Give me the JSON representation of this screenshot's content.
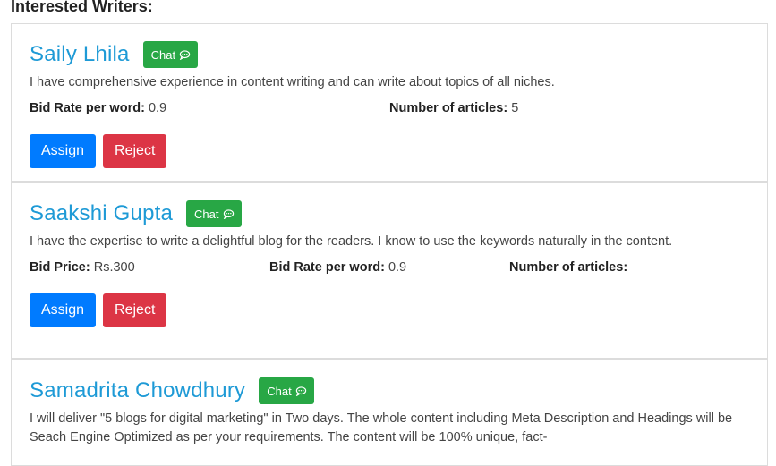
{
  "section_title": "Interested Writers:",
  "colors": {
    "name": "#1e9ad6",
    "chat": "#28a745",
    "assign": "#007bff",
    "reject": "#dc3545"
  },
  "chat_label": "Chat",
  "chat_icon": "comment-dots-icon",
  "writers": [
    {
      "name": "Saily Lhila",
      "description": "I have comprehensive experience in content writing and can write about topics of all niches.",
      "fields": [
        {
          "label": "Bid Rate per word:",
          "value": "0.9"
        },
        {
          "label": "Number of articles:",
          "value": "5"
        }
      ],
      "assign_label": "Assign",
      "reject_label": "Reject"
    },
    {
      "name": "Saakshi Gupta",
      "description": "I have the expertise to write a delightful blog for the readers. I know to use the keywords naturally in the content.",
      "fields": [
        {
          "label": "Bid Price:",
          "value": "Rs.300"
        },
        {
          "label": "Bid Rate per word:",
          "value": "0.9"
        },
        {
          "label": "Number of articles:",
          "value": ""
        }
      ],
      "assign_label": "Assign",
      "reject_label": "Reject"
    },
    {
      "name": "Samadrita Chowdhury",
      "description": "I will deliver \"5 blogs for digital marketing\" in Two days. The whole content including Meta Description and Headings will be Seach Engine Optimized as per your requirements. The content will be 100% unique, fact-"
    }
  ]
}
